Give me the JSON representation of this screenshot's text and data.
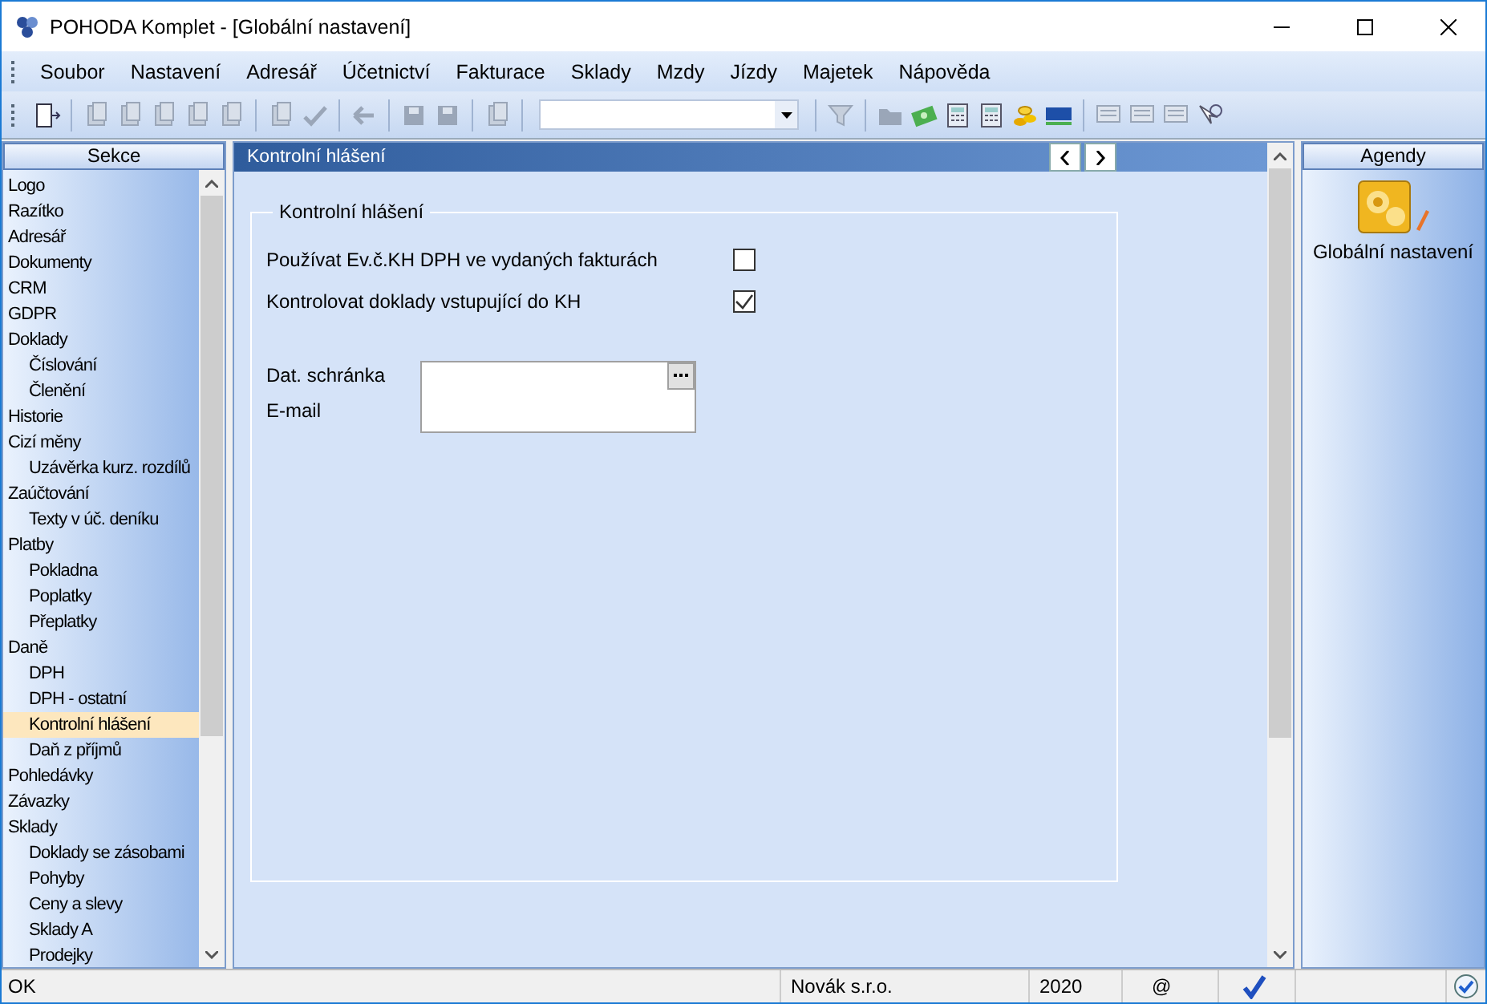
{
  "window": {
    "title": "POHODA Komplet - [Globální nastavení]"
  },
  "menu": [
    "Soubor",
    "Nastavení",
    "Adresář",
    "Účetnictví",
    "Fakturace",
    "Sklady",
    "Mzdy",
    "Jízdy",
    "Majetek",
    "Nápověda"
  ],
  "sidebar": {
    "header": "Sekce",
    "items": [
      {
        "label": "Logo",
        "selected": false
      },
      {
        "label": "Razítko",
        "selected": false
      },
      {
        "label": "Adresář",
        "selected": false
      },
      {
        "label": "Dokumenty",
        "selected": false
      },
      {
        "label": "CRM",
        "selected": false
      },
      {
        "label": "GDPR",
        "selected": false
      },
      {
        "label": "Doklady",
        "selected": false,
        "children": [
          {
            "label": "Číslování",
            "selected": false
          },
          {
            "label": "Členění",
            "selected": false
          }
        ]
      },
      {
        "label": "Historie",
        "selected": false
      },
      {
        "label": "Cizí měny",
        "selected": false,
        "children": [
          {
            "label": "Uzávěrka kurz. rozdílů",
            "selected": false
          }
        ]
      },
      {
        "label": "Zaúčtování",
        "selected": false,
        "children": [
          {
            "label": "Texty v úč. deníku",
            "selected": false
          }
        ]
      },
      {
        "label": "Platby",
        "selected": false,
        "children": [
          {
            "label": "Pokladna",
            "selected": false
          },
          {
            "label": "Poplatky",
            "selected": false
          },
          {
            "label": "Přeplatky",
            "selected": false
          }
        ]
      },
      {
        "label": "Daně",
        "selected": false,
        "children": [
          {
            "label": "DPH",
            "selected": false
          },
          {
            "label": "DPH - ostatní",
            "selected": false
          },
          {
            "label": "Kontrolní hlášení",
            "selected": true
          },
          {
            "label": "Daň z příjmů",
            "selected": false
          }
        ]
      },
      {
        "label": "Pohledávky",
        "selected": false
      },
      {
        "label": "Závazky",
        "selected": false
      },
      {
        "label": "Sklady",
        "selected": false,
        "children": [
          {
            "label": "Doklady se zásobami",
            "selected": false
          },
          {
            "label": "Pohyby",
            "selected": false
          },
          {
            "label": "Ceny a slevy",
            "selected": false
          },
          {
            "label": "Sklady A",
            "selected": false
          },
          {
            "label": "Prodejky",
            "selected": false
          }
        ]
      }
    ]
  },
  "content": {
    "header": "Kontrolní hlášení",
    "group": {
      "title": "Kontrolní hlášení",
      "checkboxes": [
        {
          "label": "Používat Ev.č.KH DPH ve vydaných fakturách",
          "checked": false
        },
        {
          "label": "Kontrolovat doklady vstupující do KH",
          "checked": true
        }
      ],
      "fields": [
        {
          "label": "Dat. schránka"
        },
        {
          "label": "E-mail"
        }
      ]
    }
  },
  "agendas": {
    "header": "Agendy",
    "items": [
      {
        "label": "Globální nastavení"
      }
    ]
  },
  "status_bar": [
    "OK",
    "Novák s.r.o.",
    "2020",
    "@"
  ]
}
